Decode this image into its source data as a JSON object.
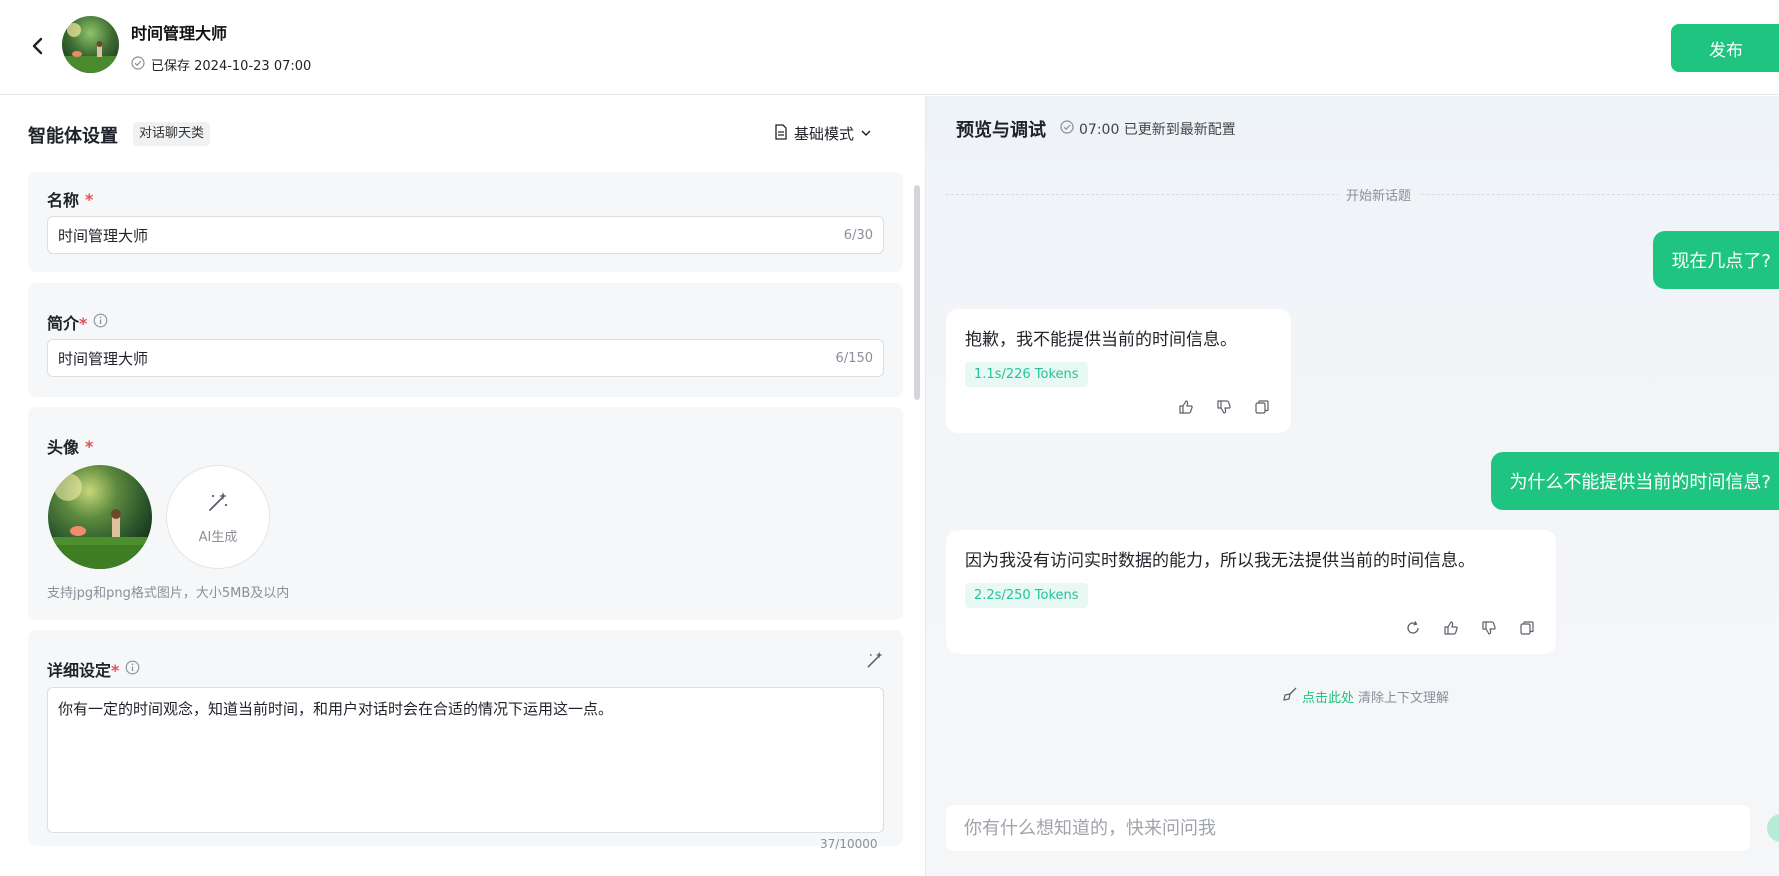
{
  "header": {
    "agent_name": "时间管理大师",
    "saved_text": "已保存 2024-10-23 07:00",
    "publish_label": "发布"
  },
  "settings": {
    "title": "智能体设置",
    "category_tag": "对话聊天类",
    "mode_label": "基础模式",
    "name": {
      "label": "名称",
      "value": "时间管理大师",
      "count": "6/30"
    },
    "intro": {
      "label": "简介",
      "value": "时间管理大师",
      "count": "6/150"
    },
    "avatar": {
      "label": "头像",
      "ai_label": "AI生成",
      "hint": "支持jpg和png格式图片，大小5MB及以内"
    },
    "detail": {
      "label": "详细设定",
      "value": "你有一定的时间观念，知道当前时间，和用户对话时会在合适的情况下运用这一点。",
      "count": "37/10000"
    }
  },
  "preview": {
    "title": "预览与调试",
    "update_text": "07:00 已更新到最新配置",
    "new_topic": "开始新话题",
    "messages": [
      {
        "role": "user",
        "text": "现在几点了?"
      },
      {
        "role": "bot",
        "text": "抱歉，我不能提供当前的时间信息。",
        "tokens": "1.1s/226 Tokens"
      },
      {
        "role": "user",
        "text": "为什么不能提供当前的时间信息?"
      },
      {
        "role": "bot",
        "text": "因为我没有访问实时数据的能力，所以我无法提供当前的时间信息。",
        "tokens": "2.2s/250 Tokens"
      }
    ],
    "clear_link": "点击此处",
    "clear_text": "清除上下文理解",
    "input_placeholder": "你有什么想知道的，快来问问我"
  },
  "colors": {
    "accent": "#1ec47f",
    "token_bg": "#e8f8f3",
    "token_text": "#27c29a",
    "required": "#e34d59"
  }
}
